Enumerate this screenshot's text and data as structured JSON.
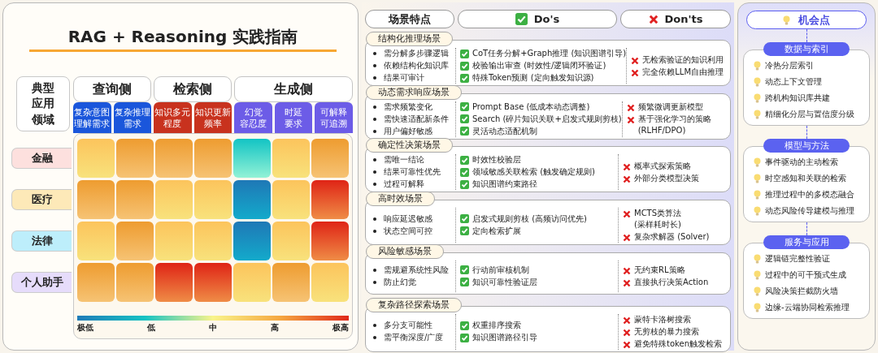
{
  "title": "RAG + Reasoning 实践指南",
  "matrix": {
    "corner": "典型应用领域",
    "groups": [
      {
        "label": "查询侧",
        "color": "#1a56db",
        "columns": [
          {
            "lines": [
              "复杂意图",
              "理解需求"
            ]
          },
          {
            "lines": [
              "复杂推理",
              "需求"
            ]
          }
        ]
      },
      {
        "label": "检索侧",
        "color": "#c8321e",
        "columns": [
          {
            "lines": [
              "知识多元",
              "程度"
            ]
          },
          {
            "lines": [
              "知识更新",
              "频率"
            ]
          }
        ]
      },
      {
        "label": "生成侧",
        "color": "#6c5ce7",
        "columns": [
          {
            "lines": [
              "幻觉",
              "容忍度"
            ]
          },
          {
            "lines": [
              "时延",
              "要求"
            ]
          },
          {
            "lines": [
              "可解释",
              "可追溯"
            ]
          }
        ]
      }
    ],
    "rows": [
      {
        "label": "金融",
        "color": "#fde0de",
        "cells": [
          {
            "kind": "medium"
          },
          {
            "kind": "high"
          },
          {
            "kind": "high"
          },
          {
            "kind": "high"
          },
          {
            "kind": "low"
          },
          {
            "kind": "medium"
          },
          {
            "kind": "high"
          }
        ]
      },
      {
        "label": "医疗",
        "color": "#fde9b8",
        "cells": [
          {
            "kind": "high"
          },
          {
            "kind": "high"
          },
          {
            "kind": "medium"
          },
          {
            "kind": "medium"
          },
          {
            "kind": "very_low"
          },
          {
            "kind": "medium"
          },
          {
            "kind": "very_high"
          }
        ]
      },
      {
        "label": "法律",
        "color": "#bdeefb",
        "cells": [
          {
            "kind": "medium"
          },
          {
            "kind": "high"
          },
          {
            "kind": "medium"
          },
          {
            "kind": "medium"
          },
          {
            "kind": "very_low"
          },
          {
            "kind": "medium"
          },
          {
            "kind": "very_high"
          }
        ]
      },
      {
        "label": "个人助手",
        "color": "#e6dcfb",
        "cells": [
          {
            "kind": "high"
          },
          {
            "kind": "high"
          },
          {
            "kind": "very_high"
          },
          {
            "kind": "very_high"
          },
          {
            "kind": "medium"
          },
          {
            "kind": "high"
          },
          {
            "kind": "medium"
          }
        ]
      }
    ],
    "legend": [
      "极低",
      "低",
      "中",
      "高",
      "极高"
    ]
  },
  "guide": {
    "headers": [
      "场景特点",
      "Do's",
      "Don'ts"
    ],
    "scenarios": [
      {
        "title": "结构化推理场景",
        "traits": [
          "需分解多步骤逻辑",
          "依赖结构化知识库",
          "结果可审计"
        ],
        "dos": [
          "CoT任务分解+Graph推理 (知识图谱引导)",
          "校验输出审查 (时效性/逻辑闭环验证)",
          "特殊Token预测 (定向触发知识源)"
        ],
        "donts": [
          "无检索验证的知识利用",
          "完全依赖LLM自由推理"
        ]
      },
      {
        "title": "动态需求响应场景",
        "traits": [
          "需求频繁变化",
          "需快速适配新条件",
          "用户偏好敏感"
        ],
        "dos": [
          "Prompt Base (低成本动态调整)",
          "Search (碎片知识关联+启发式规则剪枝)",
          "灵活动态适配机制"
        ],
        "donts": [
          "频繁微调更新模型",
          "基于强化学习的策略\n(RLHF/DPO)"
        ]
      },
      {
        "title": "确定性决策场景",
        "traits": [
          "需唯一结论",
          "结果可靠性优先",
          "过程可解释"
        ],
        "dos": [
          "时效性校验层",
          "领域敏感关联检索 (触发确定规则)",
          "知识图谱约束路径"
        ],
        "donts": [
          "概率式探索策略",
          "外部分类模型决策"
        ]
      },
      {
        "title": "高时效场景",
        "traits": [
          "响应延迟敏感",
          "状态空间可控"
        ],
        "dos": [
          "启发式规则剪枝 (高频访问优先)",
          "定向检索扩展"
        ],
        "donts": [
          "MCTS类算法\n(采样耗时长)",
          "复杂求解器 (Solver)"
        ]
      },
      {
        "title": "风险敏感场景",
        "traits": [
          "需规避系统性风险",
          "防止幻觉"
        ],
        "dos": [
          "行动前审核机制",
          "知识可靠性验证层"
        ],
        "donts": [
          "无约束RL策略",
          "直接执行决策Action"
        ]
      },
      {
        "title": "复杂路径探索场景",
        "traits": [
          "多分支可能性",
          "需平衡深度/广度"
        ],
        "dos": [
          "权重排序搜索",
          "知识图谱路径引导"
        ],
        "donts": [
          "蒙特卡洛树搜索",
          "无剪枝的暴力搜索",
          "避免特殊token触发检索"
        ]
      }
    ]
  },
  "opportunities": {
    "title": "机会点",
    "groups": [
      {
        "title": "数据与索引",
        "items": [
          "冷热分层索引",
          "动态上下文管理",
          "跨机构知识库共建",
          "精细化分层与置信度分级"
        ]
      },
      {
        "title": "模型与方法",
        "items": [
          "事件驱动的主动检索",
          "时空感知和关联的检索",
          "推理过程中的多模态融合",
          "动态风险传导建模与推理"
        ]
      },
      {
        "title": "服务与应用",
        "items": [
          "逻辑链完整性验证",
          "过程中的可干预式生成",
          "风险决策拦截防火墙",
          "边缘-云端协同检索推理"
        ]
      }
    ]
  }
}
